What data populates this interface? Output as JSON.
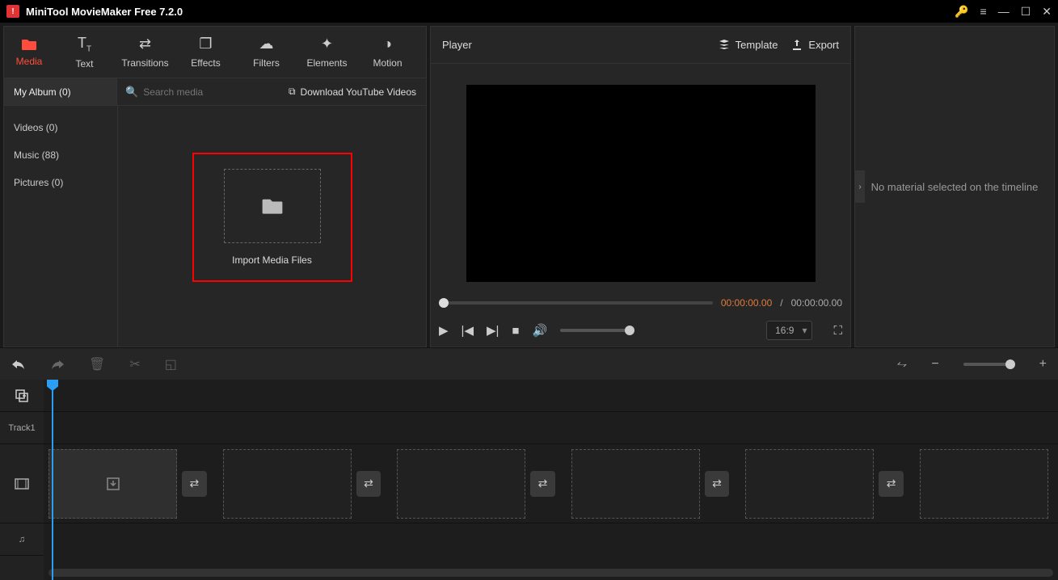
{
  "app": {
    "title": "MiniTool MovieMaker Free 7.2.0"
  },
  "tabs": {
    "media": "Media",
    "text": "Text",
    "transitions": "Transitions",
    "effects": "Effects",
    "filters": "Filters",
    "elements": "Elements",
    "motion": "Motion"
  },
  "sidebar": {
    "album": "My Album (0)",
    "search_placeholder": "Search media",
    "download": "Download YouTube Videos",
    "items": {
      "videos": "Videos (0)",
      "music": "Music (88)",
      "pictures": "Pictures (0)"
    }
  },
  "import_label": "Import Media Files",
  "player": {
    "title": "Player",
    "template": "Template",
    "export": "Export",
    "time_cur": "00:00:00.00",
    "time_sep": "/",
    "time_tot": "00:00:00.00",
    "ratio": "16:9"
  },
  "right": {
    "placeholder": "No material selected on the timeline"
  },
  "timeline": {
    "track1": "Track1"
  }
}
